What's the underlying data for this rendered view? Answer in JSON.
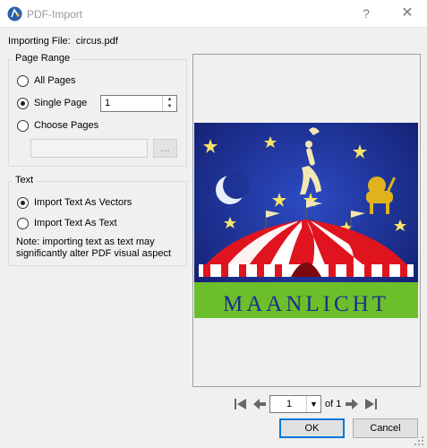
{
  "window": {
    "title": "PDF-Import",
    "help_glyph": "?",
    "close_glyph": "✕"
  },
  "importing": {
    "label": "Importing File:",
    "filename": "circus.pdf"
  },
  "page_range": {
    "title": "Page Range",
    "all_pages": "All Pages",
    "single_page": "Single Page",
    "single_page_value": "1",
    "choose_pages": "Choose Pages",
    "choose_pages_value": "",
    "browse_label": "..."
  },
  "text_group": {
    "title": "Text",
    "as_vectors": "Import Text As Vectors",
    "as_text": "Import Text As Text",
    "note": "Note: importing text as text may significantly alter PDF visual aspect"
  },
  "preview": {
    "poster_text": "MAANLICHT"
  },
  "pager": {
    "current_page": "1",
    "of_label": "of 1"
  },
  "buttons": {
    "ok": "OK",
    "cancel": "Cancel"
  },
  "colors": {
    "accent": "#0078d7",
    "poster_sky": "#1a2e8a",
    "poster_grass": "#6cbf2b",
    "poster_tent_red": "#e0141e",
    "poster_text": "#1a2e8a"
  }
}
